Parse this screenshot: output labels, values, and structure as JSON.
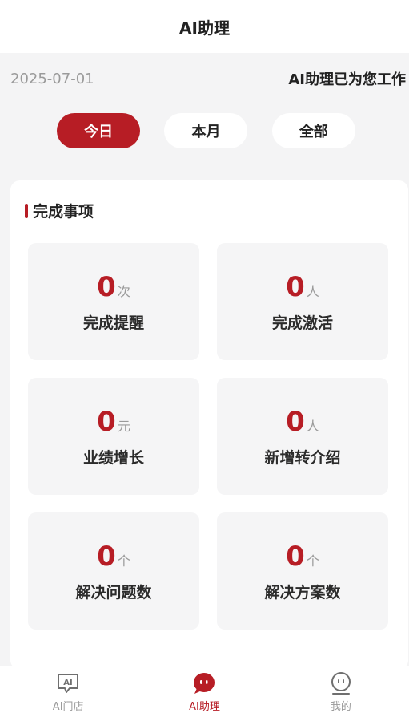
{
  "header": {
    "title": "AI助理"
  },
  "info": {
    "date": "2025-07-01",
    "status": "AI助理已为您工作"
  },
  "tabs": [
    {
      "label": "今日",
      "active": true
    },
    {
      "label": "本月",
      "active": false
    },
    {
      "label": "全部",
      "active": false
    }
  ],
  "section": {
    "title": "完成事项"
  },
  "stats": [
    {
      "value": "0",
      "unit": "次",
      "label": "完成提醒"
    },
    {
      "value": "0",
      "unit": "人",
      "label": "完成激活"
    },
    {
      "value": "0",
      "unit": "元",
      "label": "业绩增长"
    },
    {
      "value": "0",
      "unit": "人",
      "label": "新增转介绍"
    },
    {
      "value": "0",
      "unit": "个",
      "label": "解决问题数"
    },
    {
      "value": "0",
      "unit": "个",
      "label": "解决方案数"
    }
  ],
  "nav": [
    {
      "label": "AI门店",
      "icon": "ai-chat-icon",
      "active": false
    },
    {
      "label": "AI助理",
      "icon": "assistant-bubble-icon",
      "active": true
    },
    {
      "label": "我的",
      "icon": "profile-face-icon",
      "active": false
    }
  ],
  "colors": {
    "accent": "#b71d25",
    "background": "#f4f4f5",
    "muted": "#9a9a9a"
  }
}
